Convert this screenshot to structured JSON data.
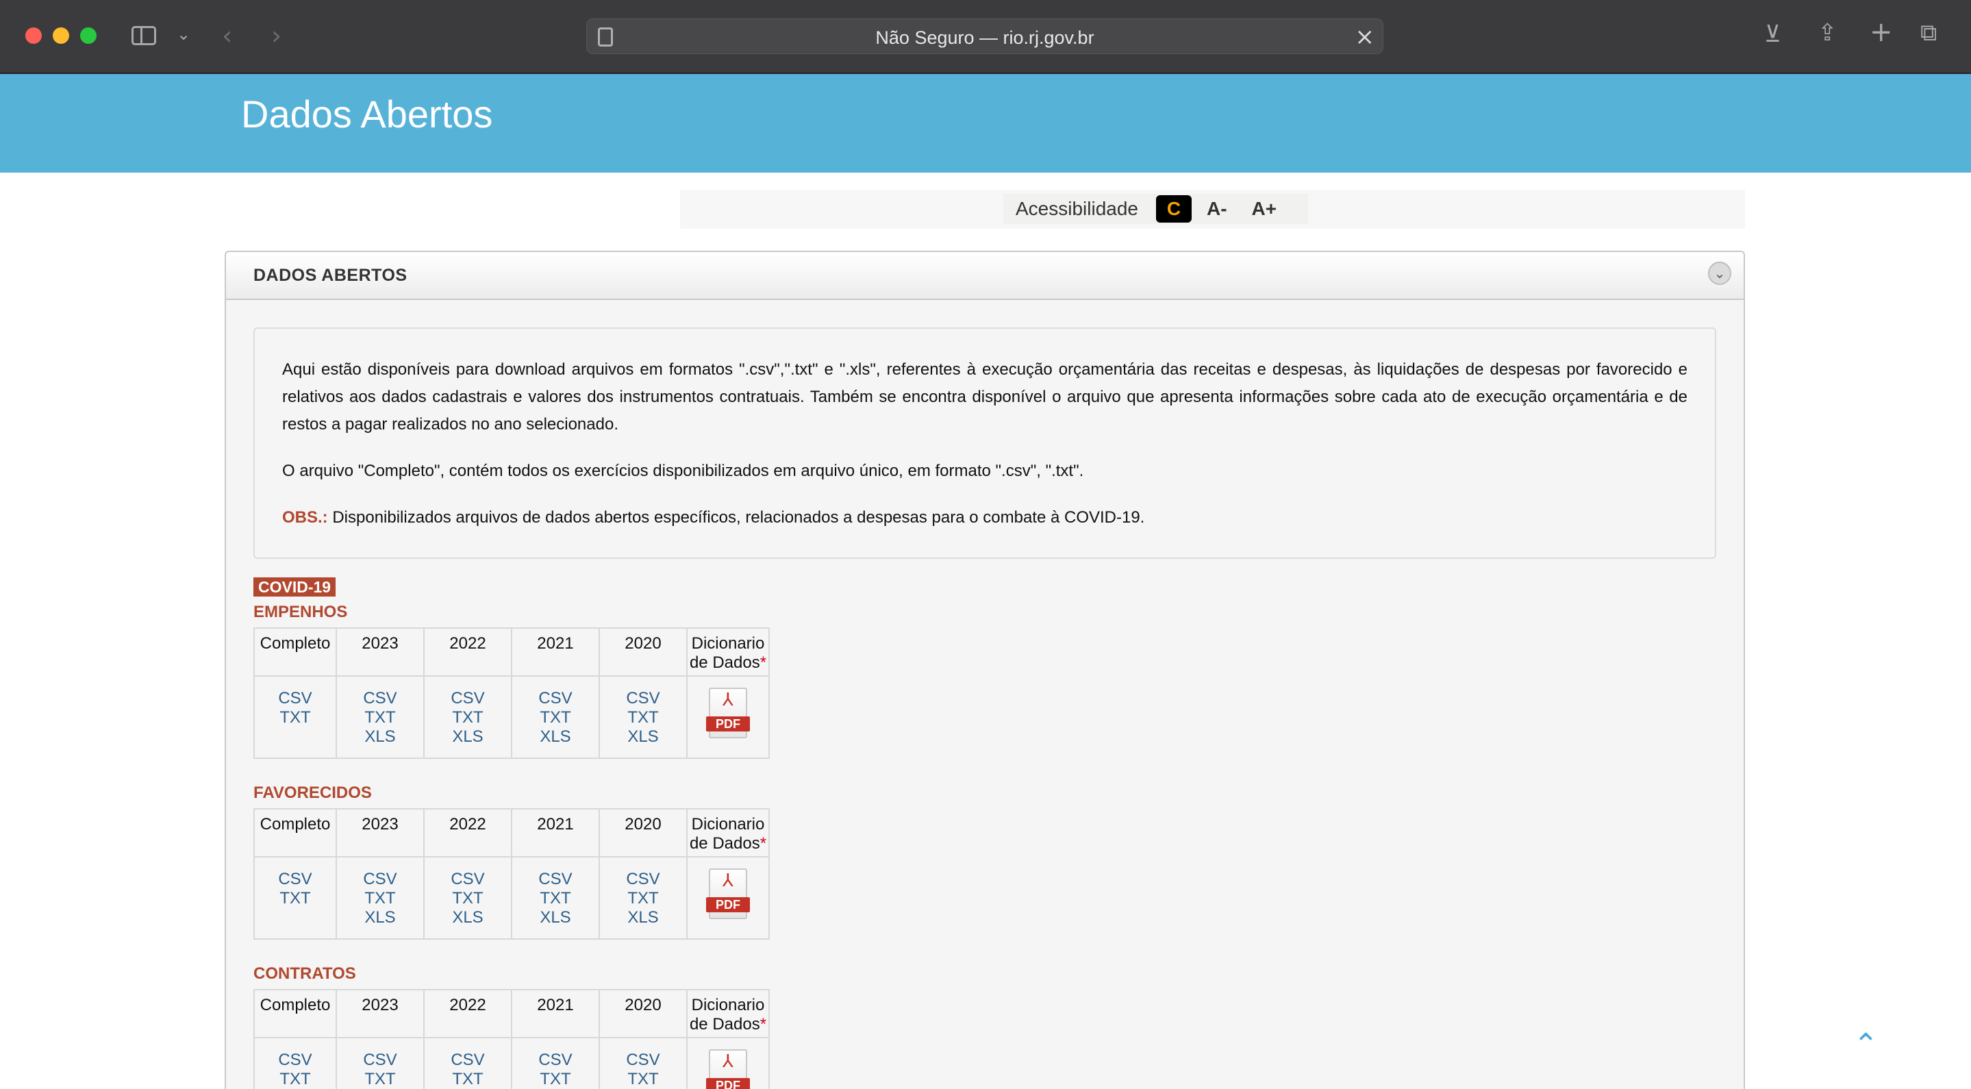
{
  "browser": {
    "url_display": "Não Seguro — rio.rj.gov.br"
  },
  "header": {
    "site_title": "Dados Abertos"
  },
  "accessibility": {
    "label": "Acessibilidade",
    "contrast": "C",
    "font_decrease": "A-",
    "font_increase": "A+"
  },
  "panel": {
    "title": "DADOS ABERTOS",
    "intro_1": "Aqui estão disponíveis para download arquivos em formatos \".csv\",\".txt\" e \".xls\", referentes à execução orçamentária das receitas e despesas, às liquidações de despesas por favorecido e relativos aos dados cadastrais e valores dos instrumentos contratuais. Também se encontra disponível o arquivo que apresenta informações sobre cada ato de execução orçamentária e de restos a pagar realizados no ano selecionado.",
    "intro_2": "O arquivo \"Completo\", contém todos os exercícios disponibilizados em arquivo único, em formato \".csv\", \".txt\".",
    "obs_label": "OBS.:",
    "obs_text": " Disponibilizados arquivos de dados abertos específicos, relacionados a despesas para o combate à COVID-19."
  },
  "covid_badge": "COVID-19",
  "table_headers": {
    "complete": "Completo",
    "y2023": "2023",
    "y2022": "2022",
    "y2021": "2021",
    "y2020": "2020",
    "dict_line1": "Dicionario",
    "dict_line2": "de Dados",
    "required_mark": "*"
  },
  "formats": {
    "csv": "CSV",
    "txt": "TXT",
    "xls": "XLS",
    "pdf": "PDF"
  },
  "sections": {
    "empenhos": "EMPENHOS",
    "favorecidos": "FAVORECIDOS",
    "contratos": "CONTRATOS"
  }
}
